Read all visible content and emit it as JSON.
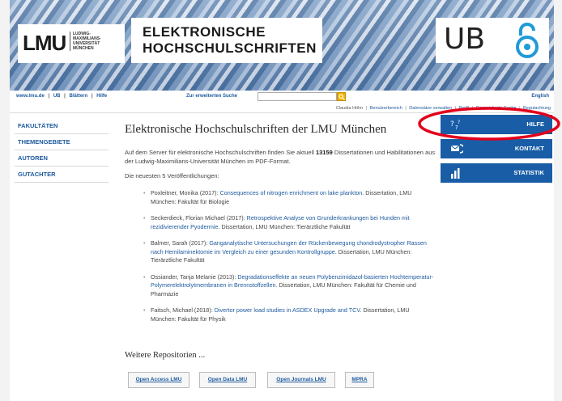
{
  "header": {
    "logo_lmu": "LMU",
    "logo_sub": [
      "LUDWIG-",
      "MAXIMILIANS-",
      "UNIVERSITÄT",
      "MÜNCHEN"
    ],
    "title_line1": "ELEKTRONISCHE",
    "title_line2": "HOCHSCHULSCHRIFTEN",
    "ub_logo": "UB"
  },
  "navbar": {
    "link_lmu": "www.lmu.de",
    "link_ub": "UB",
    "link_blaettern": "Blättern",
    "link_hilfe": "Hilfe",
    "separator": "|",
    "search_label": "Zur erweiterten Suche",
    "search_value": "",
    "language": "English"
  },
  "userbar": {
    "user_name": "Claudia Höhn",
    "separator": "|",
    "links": [
      "Benutzerbereich",
      "Datensätze verwalten",
      "Profil",
      "Gespeicherte Suche",
      "Begutachtung"
    ]
  },
  "leftnav": {
    "items": [
      "FAKULTÄTEN",
      "THEMENGEBIETE",
      "AUTOREN",
      "GUTACHTER"
    ]
  },
  "main": {
    "title": "Elektronische Hochschulschriften der LMU München",
    "intro_before": "Auf dem Server für elektronische Hochschulschriften finden Sie aktuell ",
    "intro_count": "13159",
    "intro_after": " Dissertationen und Habilitationen aus der Ludwig-Maximilians-Universität München im PDF-Format.",
    "newest_heading": "Die neuesten 5 Veröffentlichungen:",
    "publications": [
      {
        "author": "Poxleitner, Monika (2017): ",
        "title": "Consequences of nitrogen enrichment on lake plankton.",
        "info": " Dissertation, LMU München: Fakultät für Biologie"
      },
      {
        "author": "Seckerdieck, Florian Michael (2017): ",
        "title": "Retrospektive Analyse von Grunderkrankungen bei Hunden mit rezidivierender Pyodermie.",
        "info": " Dissertation, LMU München: Tierärztliche Fakultät"
      },
      {
        "author": "Balmer, Sarah (2017): ",
        "title": "Ganganalytische Untersuchungen der Rückenbewegung chondrodystropher Rassen nach Hemilaminektomie im Vergleich zu einer gesunden Kontrollgruppe.",
        "info": " Dissertation, LMU München: Tierärztliche Fakultät"
      },
      {
        "author": "Ossiander, Tanja Melanie (2013): ",
        "title": "Degradationseffekte an neuen Polybenzimidazol-basierten Hochtemperatur-Polymerelektrolytmembranen in Brennstoffzellen.",
        "info": " Dissertation, LMU München: Fakultät für Chemie und Pharmazie"
      },
      {
        "author": "Faitsch, Michael (2018): ",
        "title": "Divertor power load studies in ASDEX Upgrade and TCV.",
        "info": " Dissertation, LMU München: Fakultät für Physik"
      }
    ],
    "repos_heading": "Weitere Repositorien ...",
    "repos": [
      "Open Access LMU",
      "Open Data LMU",
      "Open Journals LMU",
      "MPRA"
    ]
  },
  "rightnav": {
    "help_label": "HILFE",
    "contact_label": "KONTAKT",
    "stats_label": "STATISTIK"
  },
  "colors": {
    "link_blue": "#1d5a9e",
    "panel_blue": "#1a5da7",
    "search_button": "#f3b100",
    "annotation_red": "#e3001b"
  }
}
